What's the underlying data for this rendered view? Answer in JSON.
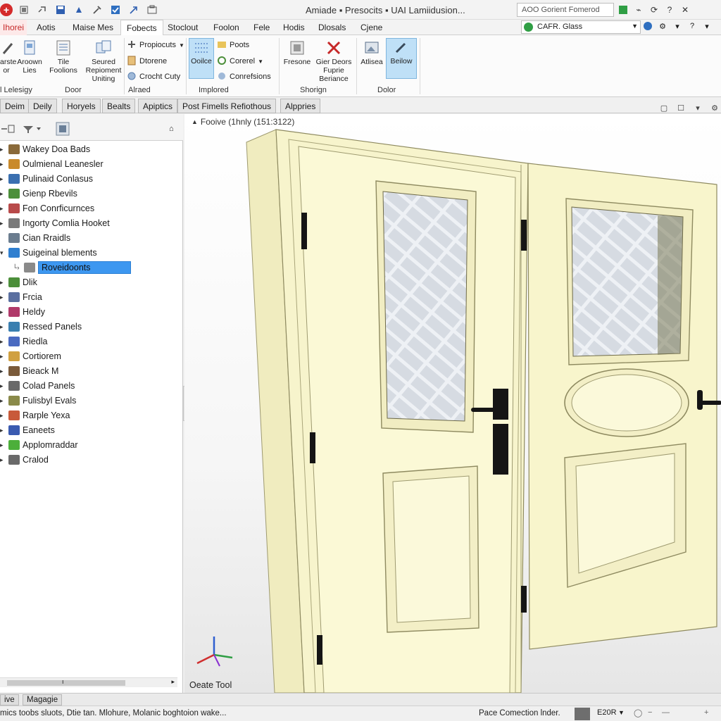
{
  "titlebar": {
    "title": "Amiade ▪ Presocits ▪ UAI Lamiidusion...",
    "search_value": "AOO Gorient Fomerod",
    "qat_icons": [
      "add-icon",
      "home-icon",
      "link-icon",
      "save-icon",
      "up-icon",
      "tools-icon",
      "check-icon",
      "arrow-icon",
      "window-icon"
    ]
  },
  "ribbon_tabs": {
    "file": "Ihorei",
    "tabs": [
      "Aotis",
      "Maise Mes",
      "Fobects",
      "Stoclout",
      "Foolon",
      "Fele",
      "Hodis",
      "Dlosals",
      "Cjene"
    ],
    "active_index": 2,
    "search_value": "CAFR. Glass"
  },
  "ribbon": {
    "group_left": {
      "btn1": "arste or",
      "btn2": "Aroown Lies",
      "btn3": "Tile Foolions",
      "btn4": "Seured Repioment Uniting",
      "label_a": "l Lelesigy",
      "label_b": "Door"
    },
    "group_aligned": {
      "item1": "Propiocuts",
      "item2": "Dtorene",
      "item3": "Crocht Cuty",
      "label": "Alraed"
    },
    "group_implored": {
      "btn": "Ooilce",
      "item1": "Poots",
      "item2": "Corerel",
      "item3": "Conrefsions",
      "label": "Implored"
    },
    "group_shorign": {
      "btn1": "Fresone",
      "btn2": "Gier Deors Fuprie Beriance",
      "label": "Shorign"
    },
    "group_dolor": {
      "btn1": "Atlisea",
      "btn2": "Beilow",
      "label": "Dolor"
    }
  },
  "property_tabs": [
    "Deim",
    "Deily",
    "Horyels",
    "Bealts",
    "Apiptics",
    "Post Fimells Refiothous",
    "Alppries"
  ],
  "browser": {
    "items": [
      {
        "label": "Wakey Doa Bads",
        "color": "#8a6a3a"
      },
      {
        "label": "Oulmienal Leanesler",
        "color": "#c98a2b"
      },
      {
        "label": "Pulinaid Conlasus",
        "color": "#3a6fb0"
      },
      {
        "label": "Gienp Rbevils",
        "color": "#4c8f3a"
      },
      {
        "label": "Fon Conrficurnces",
        "color": "#b84a4a"
      },
      {
        "label": "Ingorty Comlia Hooket",
        "color": "#7a7a7a"
      },
      {
        "label": "Cian Rraidls",
        "color": "#6b7d8f"
      },
      {
        "label": "Suigeinal blements",
        "color": "#2f7fd0"
      },
      {
        "label": "Roveidoonts",
        "color": "#8a8a8a",
        "selected": true
      },
      {
        "label": "Dlik",
        "color": "#4c8f3a"
      },
      {
        "label": "Frcia",
        "color": "#5a6fa0"
      },
      {
        "label": "Heldy",
        "color": "#b03a6a"
      },
      {
        "label": "Ressed Panels",
        "color": "#3a7fb0"
      },
      {
        "label": "Riedla",
        "color": "#4a6ac0"
      },
      {
        "label": "Cortiorem",
        "color": "#d0a040"
      },
      {
        "label": "Bieack M",
        "color": "#7a5a3a"
      },
      {
        "label": "Colad Panels",
        "color": "#6a6a6a"
      },
      {
        "label": "Fulisbyl Evals",
        "color": "#8a8a4a"
      },
      {
        "label": "Rarple Yexa",
        "color": "#c85a3a"
      },
      {
        "label": "Eaneets",
        "color": "#3a5ab0"
      },
      {
        "label": "Applomraddar",
        "color": "#4caf3a"
      },
      {
        "label": "Cralod",
        "color": "#6a6a6a"
      }
    ]
  },
  "viewport": {
    "view_label": "Fooive (1hnly (151:3122)",
    "create_tool": "Oeate Tool"
  },
  "bottom_tabs": [
    "ive",
    "Magagie"
  ],
  "status": {
    "left": "mics toobs sluots, Dtie tan. Mlohure, Molanic boghtoion wake...",
    "right": "Pace Comection lnder.",
    "zoom": "E20R"
  },
  "colors": {
    "door_fill": "#f8f6cf",
    "door_edge": "#e6e2b2",
    "handle": "#1a1a1a",
    "glass": "#d8dde3",
    "selected_row": "#3d97f0"
  }
}
